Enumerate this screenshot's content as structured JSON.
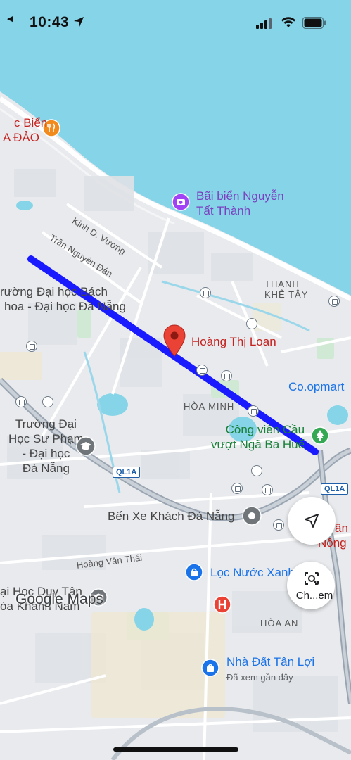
{
  "status_bar": {
    "time": "10:43"
  },
  "map": {
    "labels": {
      "beach_top_line1": "c Biển",
      "beach_top_line2": "A ĐẢO",
      "beach_nguyen_line1": "Bãi biển Nguyễn",
      "beach_nguyen_line2": "Tất Thành",
      "street_kinh_d_vuong": "Kinh D. Vương",
      "street_tran_nguyen_dan": "Trần Nguyên Đán",
      "university_bach_khoa_line1": "rường Đại học Bách",
      "university_bach_khoa_line2": "hoa - Đại học Đà Nẵng",
      "area_thanh_khe_tay_line1": "THANH",
      "area_thanh_khe_tay_line2": "KHÊ TÂY",
      "destination_pin": "Hoàng Thị Loan",
      "area_hoa_minh": "HÒA MINH",
      "coopmart": "Co.opmart",
      "park_line1": "Công viên Cầu",
      "park_line2": "vượt Ngã Ba Huế",
      "university_su_pham_line1": "Trường Đại",
      "university_su_pham_line2": "Học Sư Phạm",
      "university_su_pham_line3": "- Đại học",
      "university_su_pham_line4": "Đà Nẵng",
      "highway_ql1a_left": "QL1A",
      "highway_ql1a_right": "QL1A",
      "bus_station": "Bến Xe Khách Đà Nẵng",
      "right_edge_line1": "ân",
      "right_edge_line2": "Nông",
      "street_hoang_van_thai": "Hoàng Văn Thái",
      "water_filter": "Lọc Nước Xanh",
      "duy_tan_line1": "ại Học Duy Tân",
      "duy_tan_line2": "òa Khánh Nam",
      "area_hoa_an": "HÒA AN",
      "real_estate": "Nhà Đất Tân Lợi",
      "viewed_recently": "Đã xem gần đây",
      "google_logo": "Google Maps"
    }
  },
  "controls": {
    "location_button_icon": "navigation-arrow-icon",
    "camera_button_label": "Ch...em"
  },
  "colors": {
    "sea": "#7fd3e6",
    "route": "#1a1aff",
    "pin": "#ea4335"
  }
}
